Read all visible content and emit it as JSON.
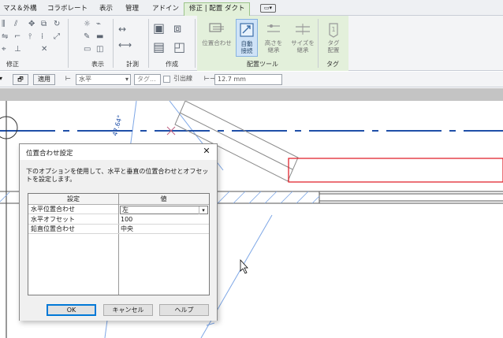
{
  "ribbon_tabs": [
    "マス＆外構",
    "コラボレート",
    "表示",
    "管理",
    "アドイン",
    "修正 | 配置 ダクト"
  ],
  "quick_menu_glyph": "▭▾",
  "ribbon_groups": {
    "modify": "修正",
    "view": "表示",
    "measure": "計測",
    "create": "作成",
    "place_tools": "配置ツール",
    "tag": "タグ"
  },
  "ribbon_buttons": {
    "justify": "位置合わせ",
    "auto_connect_1": "自動",
    "auto_connect_2": "接続",
    "inherit_elevation_1": "高さを",
    "inherit_elevation_2": "継承",
    "inherit_size_1": "サイズを",
    "inherit_size_2": "継承",
    "tag_on_placement_1": "タグ",
    "tag_on_placement_2": "配置"
  },
  "options_bar": {
    "apply_label": "適用",
    "justification_value": "水平",
    "tag_placeholder": "タグ...",
    "leader_label": "引出線",
    "length_value": "12.7 mm"
  },
  "canvas": {
    "angle_label": "47.64°"
  },
  "dialog": {
    "title": "位置合わせ設定",
    "close_glyph": "✕",
    "description": "下のオプションを使用して、水平と垂直の位置合わせとオフセットを設定します。",
    "col_param": "設定",
    "col_value": "値",
    "rows": [
      {
        "param": "水平位置合わせ",
        "value": "左"
      },
      {
        "param": "水平オフセット",
        "value": "100"
      },
      {
        "param": "鉛直位置合わせ",
        "value": "中央"
      }
    ],
    "ok_label": "OK",
    "cancel_label": "キャンセル",
    "help_label": "ヘルプ"
  },
  "colors": {
    "context_tab": "#e2f0d9",
    "dialog_bg": "#f0f0f0",
    "duct_outline": "#e0141e",
    "gridline": "#1f4fa8",
    "accent": "#0078d7"
  }
}
